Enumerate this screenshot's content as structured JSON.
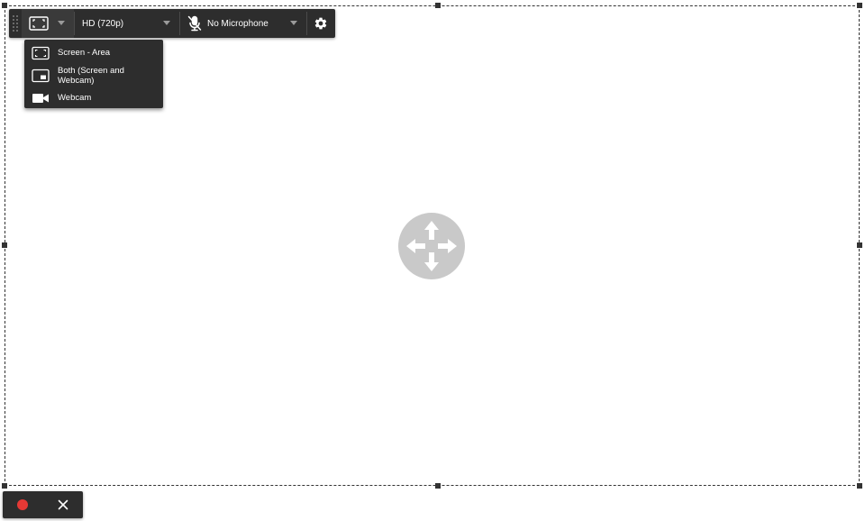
{
  "toolbar": {
    "capture_mode_icon": "screen-area-icon",
    "resolution": "HD (720p)",
    "microphone": "No Microphone",
    "settings_icon": "gear-icon"
  },
  "capture_mode_menu": {
    "items": [
      {
        "label": "Screen - Area",
        "icon": "screen-area-icon"
      },
      {
        "label": "Both (Screen and Webcam)",
        "icon": "screen-webcam-icon"
      },
      {
        "label": "Webcam",
        "icon": "webcam-icon"
      }
    ]
  },
  "recording_controls": {
    "record_icon": "record-icon",
    "close_icon": "close-icon"
  },
  "colors": {
    "panel": "#2d2d2d",
    "record": "#e53935",
    "move_handle": "#c9c9c9",
    "border": "#333333"
  }
}
